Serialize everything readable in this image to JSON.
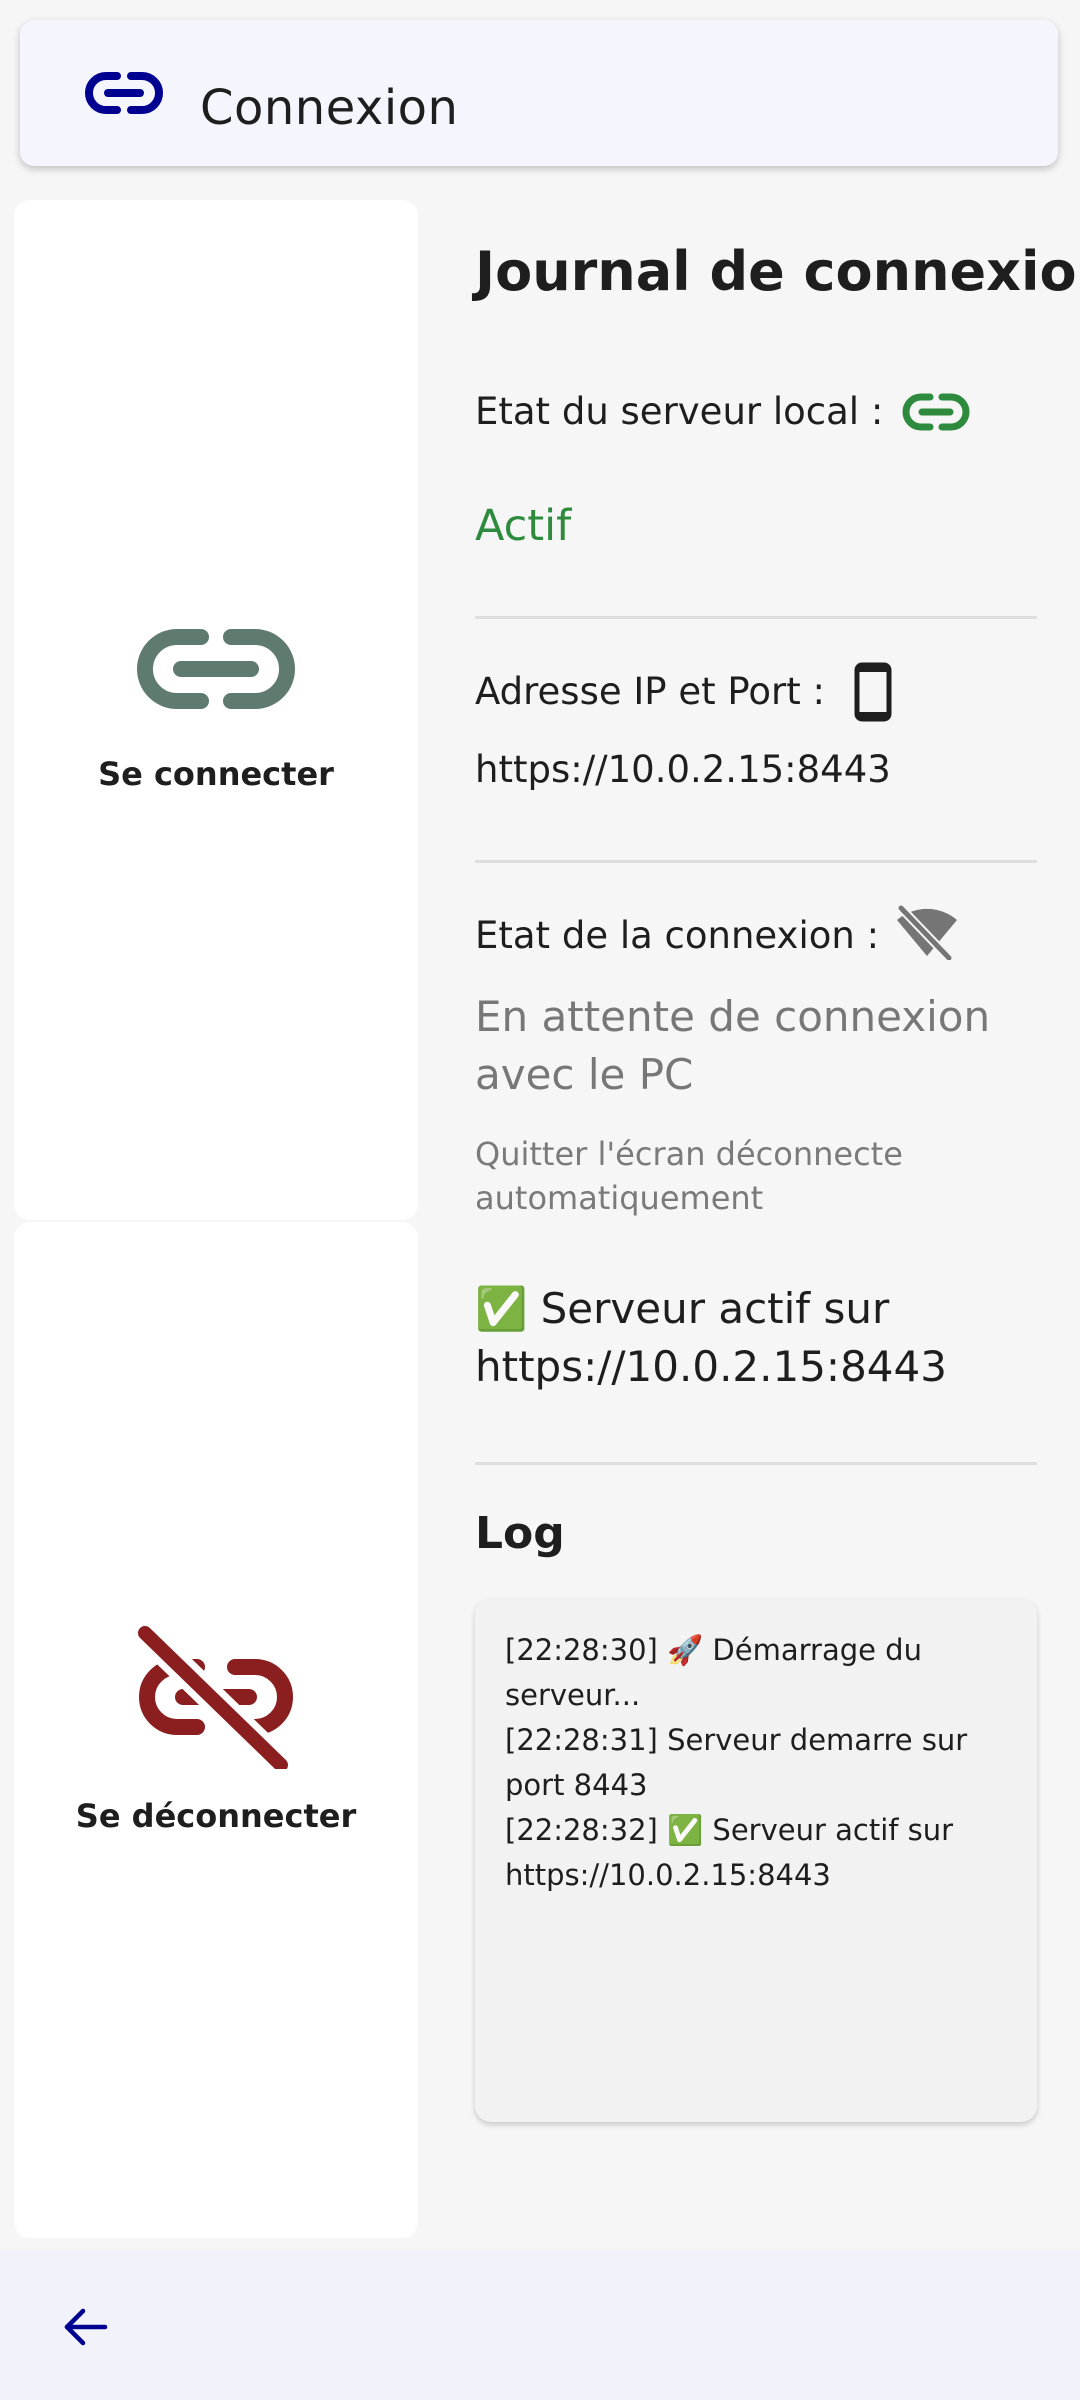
{
  "app_bar": {
    "title": "Connexion",
    "icon": "link-icon"
  },
  "actions": {
    "connect_label": "Se connecter",
    "connect_icon": "link-icon",
    "disconnect_label": "Se déconnecter",
    "disconnect_icon": "link-off-icon"
  },
  "journal": {
    "title": "Journal de connexion",
    "server_state_label": "Etat du serveur local :",
    "server_state_value": "Actif",
    "ip_label": "Adresse IP et Port :",
    "ip_value": "https://10.0.2.15:8443",
    "connection_label": "Etat de la connexion :",
    "connection_value": "En attente de connexion avec le PC",
    "connection_hint": "Quitter l'écran déconnecte automatiquement",
    "server_message": "✅ Serveur actif sur https://10.0.2.15:8443"
  },
  "log": {
    "title": "Log",
    "lines": [
      "[22:28:30] 🚀 Démarrage du serveur...",
      "[22:28:31] Serveur demarre sur port 8443",
      "[22:28:32] ✅ Serveur actif sur https://10.0.2.15:8443"
    ]
  },
  "colors": {
    "brand_blue": "#000091",
    "active_green": "#2e8b3e",
    "connect_icon": "#5f7a6e",
    "disconnect_icon": "#8b1f1f"
  }
}
